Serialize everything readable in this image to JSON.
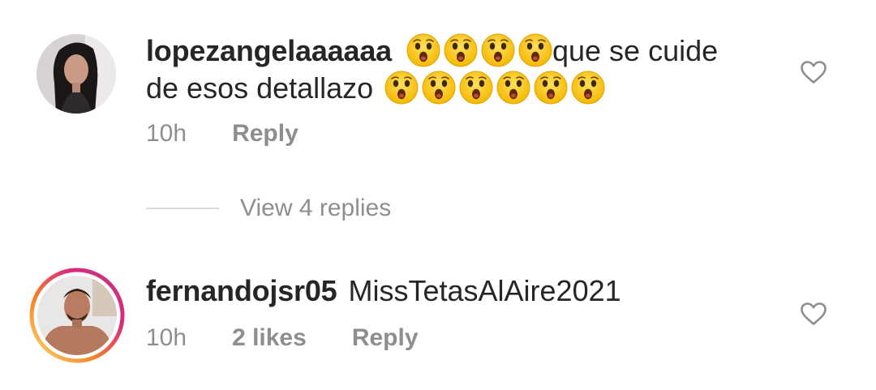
{
  "comments": [
    {
      "username": "lopezangelaaaaaa",
      "text_line1_after": "que  se cuide",
      "text_line2_before": "de esos detallazo",
      "emoji_line1_count": 4,
      "emoji_line2_count": 6,
      "time": "10h",
      "reply_label": "Reply",
      "view_replies_label": "View 4 replies"
    },
    {
      "username": "fernandojsr05",
      "text": "MissTetasAlAire2021",
      "time": "10h",
      "likes": "2 likes",
      "reply_label": "Reply",
      "story_ring": true
    }
  ],
  "colors": {
    "text": "#262626",
    "secondary": "#8e8e8e",
    "divider": "#dbdbdb",
    "ring_start": "#f58529",
    "ring_mid": "#dd2a7b",
    "ring_end": "#feda77"
  },
  "icons": {
    "like": "heart-outline-icon",
    "emoji": "astonished-face-emoji"
  }
}
